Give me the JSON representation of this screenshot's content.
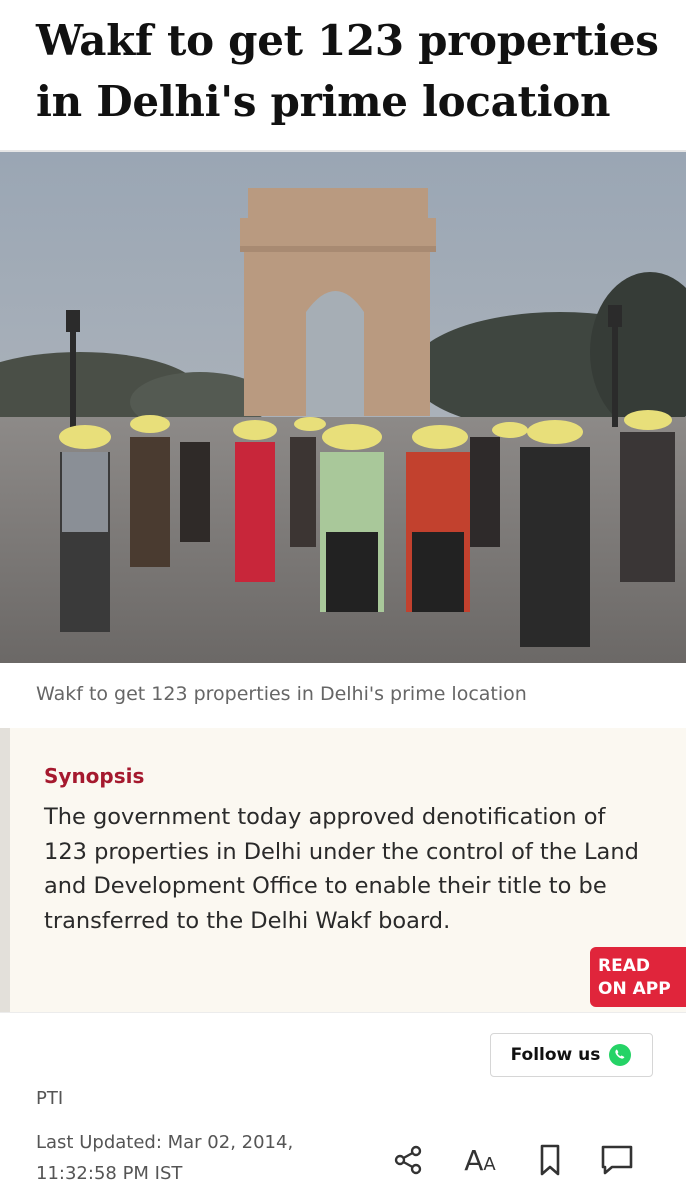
{
  "article": {
    "headline": "Wakf to get 123 properties in Delhi's prime location",
    "image_caption": "Wakf to get 123 properties in Delhi's prime location",
    "author": "PTI",
    "updated": "Last Updated: Mar 02, 2014, 11:32:58 PM IST"
  },
  "synopsis": {
    "title": "Synopsis",
    "text": "The government today approved denotification of 123 properties in Delhi under the control of the Land and Development Office to enable their title to be transferred to the Delhi Wakf board.",
    "read_app_line1": "READ",
    "read_app_line2": "ON APP"
  },
  "follow": {
    "label": "Follow us",
    "icon": "whatsapp-icon"
  },
  "actions": {
    "icons": [
      "share-icon",
      "font-size-icon",
      "bookmark-icon",
      "comment-icon"
    ],
    "font_size_label_big": "A",
    "font_size_label_small": "A"
  },
  "colors": {
    "synopsis_title": "#a5192e",
    "read_app_bg": "#e0253b",
    "whatsapp": "#25d366",
    "synopsis_bg": "#fbf8f1"
  }
}
